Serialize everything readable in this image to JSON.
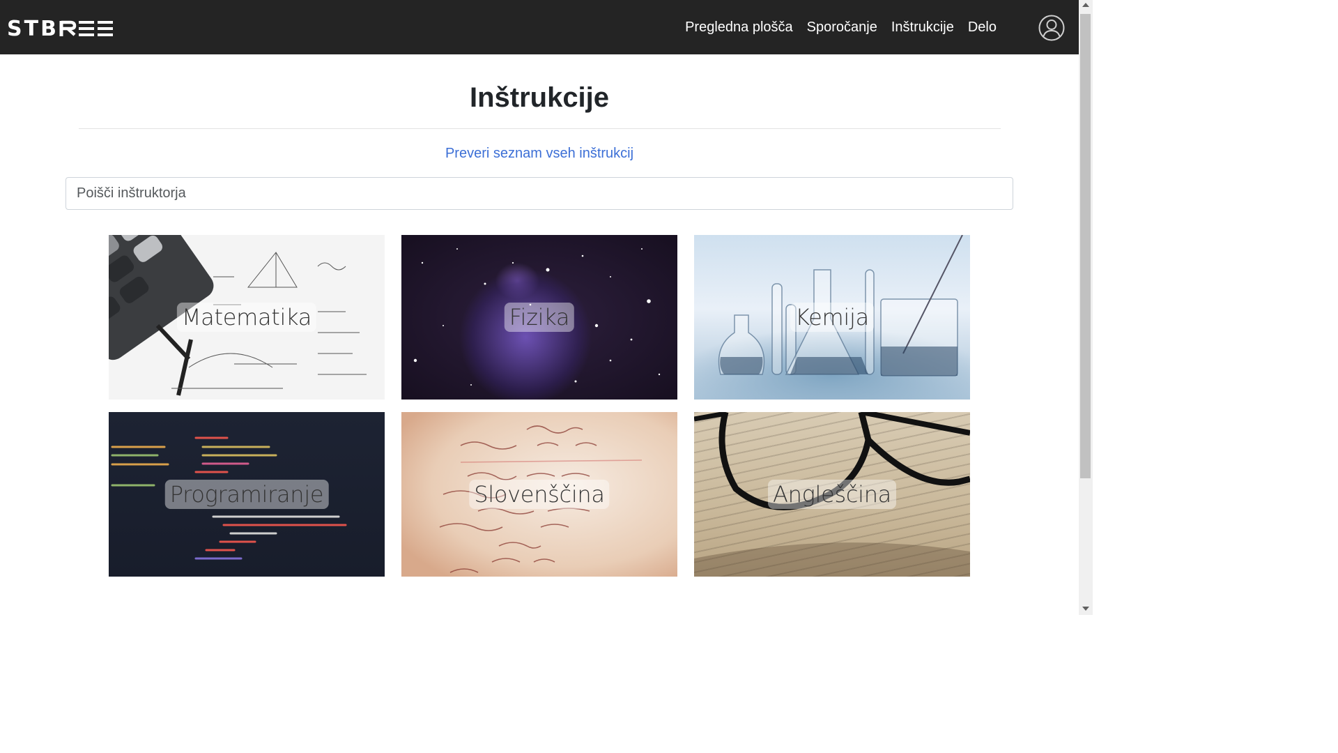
{
  "app": {
    "brand_text": "STBREE",
    "brand_prefix": "STB",
    "brand_suffix": "EE"
  },
  "nav": {
    "items": [
      {
        "label": "Pregledna plošča"
      },
      {
        "label": "Sporočanje"
      },
      {
        "label": "Inštrukcije"
      },
      {
        "label": "Delo"
      }
    ],
    "profile_icon": "user-circle-icon"
  },
  "main": {
    "title": "Inštrukcije",
    "all_link": "Preveri seznam vseh inštrukcij",
    "search": {
      "placeholder": "Poišči inštruktorja",
      "value": ""
    },
    "subjects": [
      {
        "label": "Matematika"
      },
      {
        "label": "Fizika"
      },
      {
        "label": "Kemija"
      },
      {
        "label": "Programiranje"
      },
      {
        "label": "Slovenščina"
      },
      {
        "label": "Angleščina"
      }
    ]
  },
  "colors": {
    "navbar": "#242424",
    "link": "#3c6fd6",
    "title": "#212529"
  }
}
